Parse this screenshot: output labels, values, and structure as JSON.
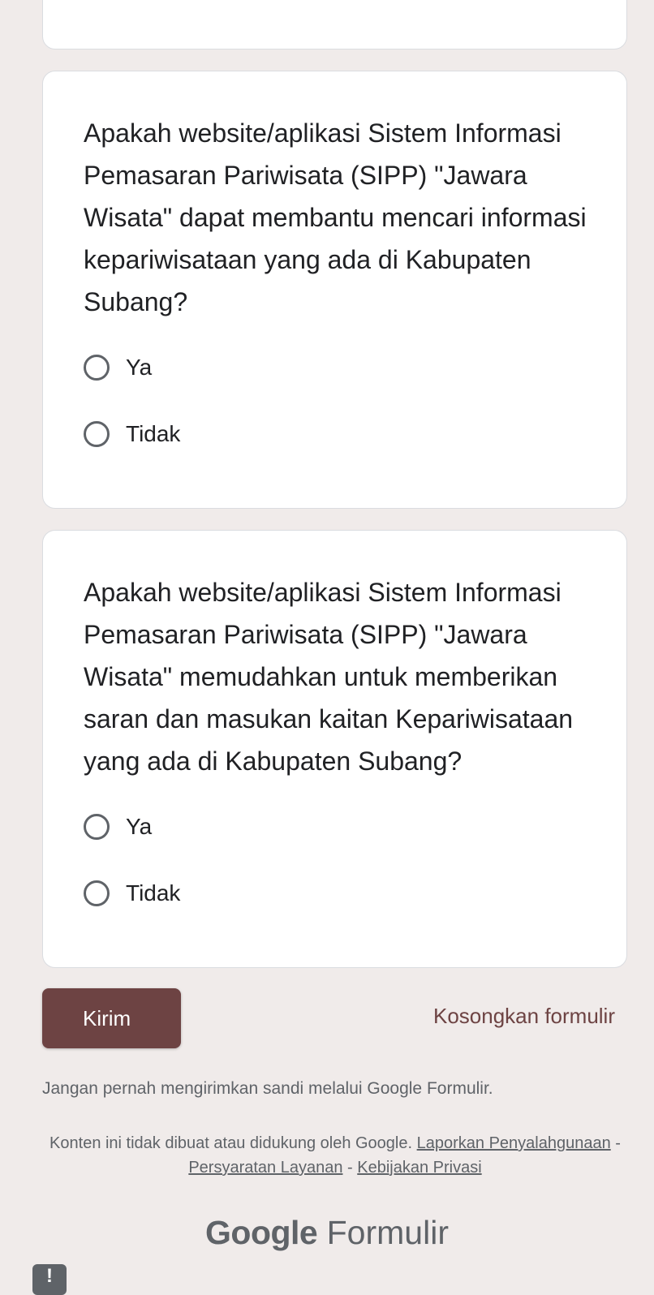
{
  "questions": [
    {
      "text": "Apakah website/aplikasi Sistem Informasi Pemasaran Pariwisata (SIPP) \"Jawara Wisata\" dapat membantu mencari informasi kepariwisataan yang ada di Kabupaten Subang?",
      "options": [
        "Ya",
        "Tidak"
      ]
    },
    {
      "text": "Apakah website/aplikasi Sistem Informasi Pemasaran Pariwisata (SIPP) \"Jawara Wisata\" memudahkan untuk memberikan saran dan masukan kaitan Kepariwisataan yang ada di Kabupaten Subang?",
      "options": [
        "Ya",
        "Tidak"
      ]
    }
  ],
  "actions": {
    "submit_label": "Kirim",
    "clear_label": "Kosongkan formulir"
  },
  "footer": {
    "warning": "Jangan pernah mengirimkan sandi melalui Google Formulir.",
    "disclaimer": "Konten ini tidak dibuat atau didukung oleh Google.",
    "report_link": "Laporkan Penyalahgunaan",
    "separator": " - ",
    "terms_link": "Persyaratan Layanan",
    "privacy_link": "Kebijakan Privasi",
    "brand_google": "Google",
    "brand_product": "Formulir",
    "feedback_icon_glyph": "!"
  },
  "colors": {
    "accent": "#6d4343",
    "background": "#f0ebea",
    "card": "#ffffff"
  }
}
